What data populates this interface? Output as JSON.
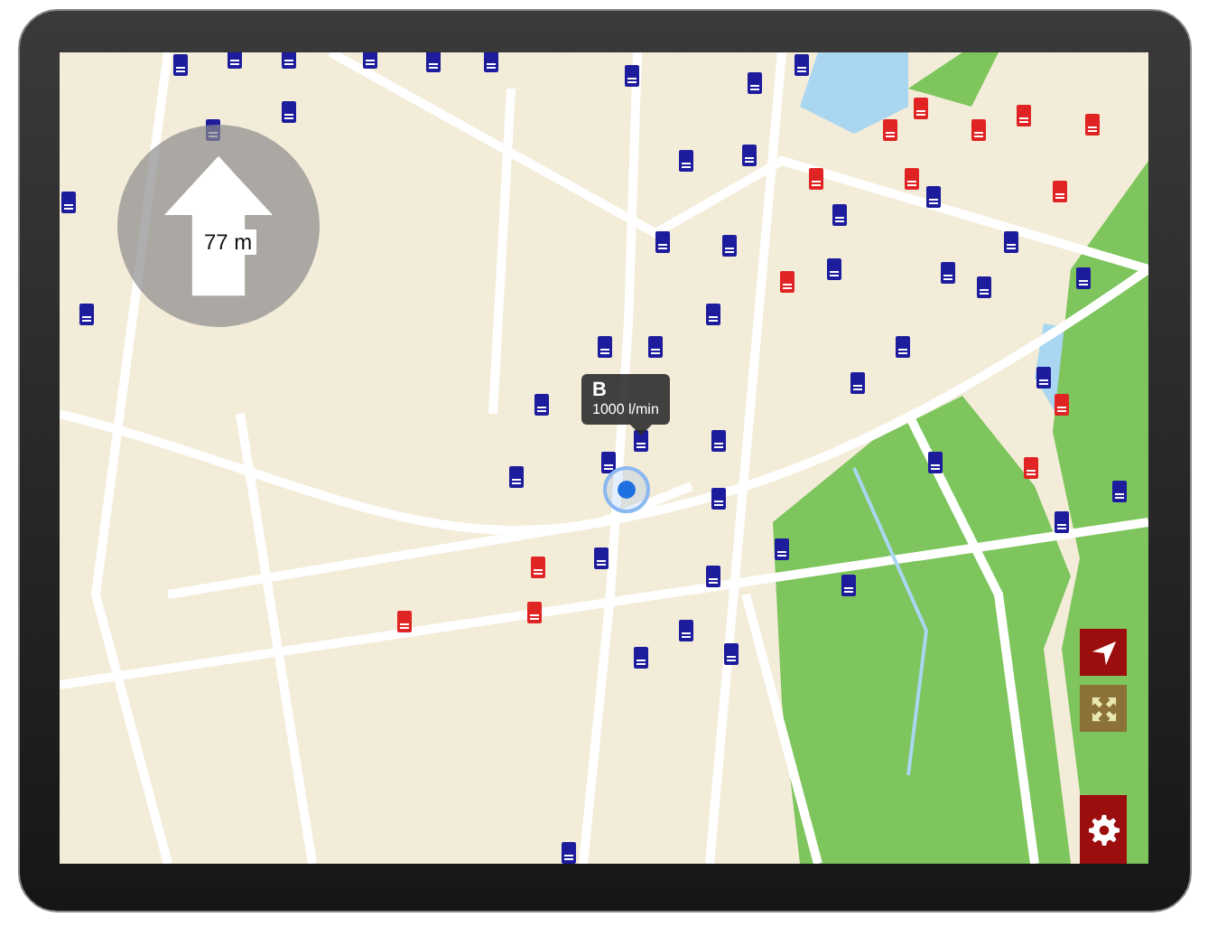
{
  "distance": {
    "label": "77 m"
  },
  "callout": {
    "title": "B",
    "text": "1000 l/min"
  },
  "buttons": [
    {
      "kind": "locate",
      "disabled": false
    },
    {
      "kind": "fullscreen",
      "disabled": true
    },
    {
      "kind": "settings",
      "disabled": false
    }
  ],
  "markers": [
    {
      "color": "#1c1c9c"
    },
    {
      "color": "#1c1c9c"
    },
    {
      "color": "#1c1c9c"
    },
    {
      "color": "#1c1c9c"
    },
    {
      "color": "#1c1c9c"
    },
    {
      "color": "#1c1c9c"
    },
    {
      "color": "#1c1c9c"
    },
    {
      "color": "#1c1c9c"
    },
    {
      "color": "#1c1c9c"
    },
    {
      "color": "#1c1c9c"
    },
    {
      "color": "#1c1c9c"
    },
    {
      "color": "#1c1c9c"
    },
    {
      "color": "#1c1c9c"
    },
    {
      "color": "#1c1c9c"
    },
    {
      "color": "#1c1c9c"
    },
    {
      "color": "#1c1c9c"
    },
    {
      "color": "#1c1c9c"
    },
    {
      "color": "#1c1c9c"
    },
    {
      "color": "#1c1c9c"
    },
    {
      "color": "#1c1c9c"
    },
    {
      "color": "#1c1c9c"
    },
    {
      "color": "#1c1c9c"
    },
    {
      "color": "#1c1c9c"
    },
    {
      "color": "#1c1c9c"
    },
    {
      "color": "#1c1c9c"
    },
    {
      "color": "#1c1c9c"
    },
    {
      "color": "#1c1c9c"
    },
    {
      "color": "#1c1c9c"
    },
    {
      "color": "#1c1c9c"
    },
    {
      "color": "#1c1c9c"
    },
    {
      "color": "#1c1c9c"
    },
    {
      "color": "#1c1c9c"
    },
    {
      "color": "#1c1c9c"
    },
    {
      "color": "#1c1c9c"
    },
    {
      "color": "#1c1c9c"
    },
    {
      "color": "#1c1c9c"
    },
    {
      "color": "#1c1c9c"
    },
    {
      "color": "#1c1c9c"
    },
    {
      "color": "#1c1c9c"
    },
    {
      "color": "#1c1c9c"
    },
    {
      "color": "#1c1c9c"
    },
    {
      "color": "#1c1c9c"
    },
    {
      "color": "#1c1c9c"
    },
    {
      "color": "#1c1c9c"
    },
    {
      "color": "#1c1c9c"
    },
    {
      "color": "#1c1c9c"
    },
    {
      "color": "#1c1c9c"
    },
    {
      "color": "#e02424"
    },
    {
      "color": "#e02424"
    },
    {
      "color": "#e02424"
    },
    {
      "color": "#e02424"
    },
    {
      "color": "#e02424"
    },
    {
      "color": "#e02424"
    },
    {
      "color": "#e02424"
    },
    {
      "color": "#e02424"
    },
    {
      "color": "#e02424"
    },
    {
      "color": "#e02424"
    },
    {
      "color": "#e02424"
    },
    {
      "color": "#e02424"
    },
    {
      "color": "#e02424"
    },
    {
      "color": "#e02424"
    }
  ]
}
